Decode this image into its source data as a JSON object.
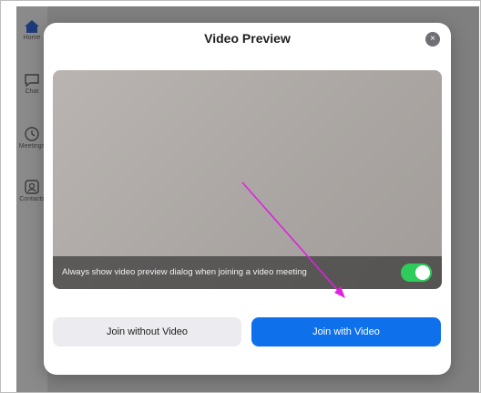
{
  "sidebar": {
    "items": [
      {
        "label": "Home",
        "icon": "home-icon"
      },
      {
        "label": "Chat",
        "icon": "chat-icon"
      },
      {
        "label": "Meetings",
        "icon": "clock-icon"
      },
      {
        "label": "Contacts",
        "icon": "contacts-icon"
      }
    ]
  },
  "dialog": {
    "title": "Video Preview",
    "close_icon": "×",
    "preview_bar_text": "Always show video preview dialog when joining a video meeting",
    "toggle_on": true,
    "join_without_video_label": "Join without Video",
    "join_with_video_label": "Join with Video"
  },
  "colors": {
    "primary": "#0e71eb",
    "toggle_on": "#2ecc5a",
    "annotation_arrow": "#e020e0"
  }
}
